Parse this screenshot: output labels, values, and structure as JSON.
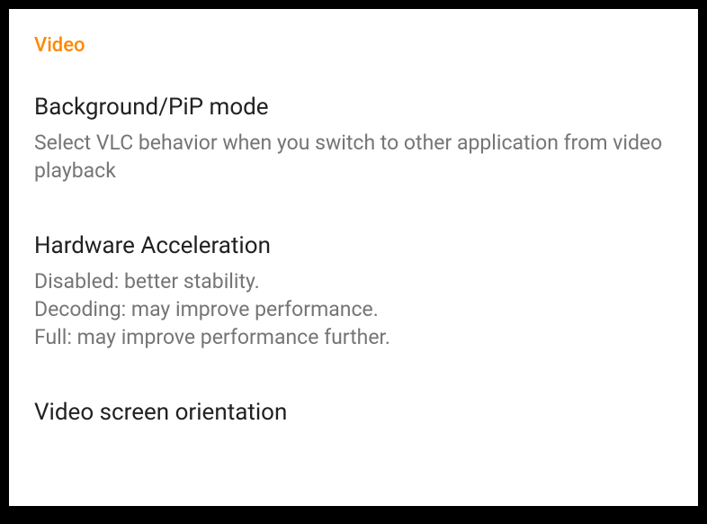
{
  "section": {
    "header": "Video"
  },
  "settings": {
    "pip": {
      "title": "Background/PiP mode",
      "description": "Select VLC behavior when you switch to other application from video playback"
    },
    "hwaccel": {
      "title": "Hardware Acceleration",
      "description": "Disabled: better stability.\nDecoding: may improve performance.\nFull: may improve performance further."
    },
    "orientation": {
      "title": "Video screen orientation"
    }
  }
}
